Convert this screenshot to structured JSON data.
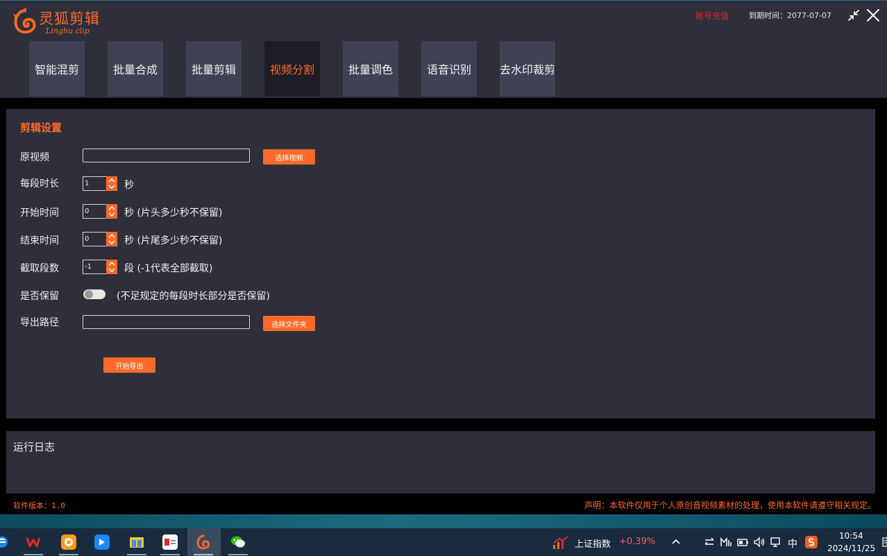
{
  "app": {
    "title": "灵狐剪辑",
    "subtitle": "Linghu clip",
    "recharge": "账号充值",
    "expiry": "到期时间：2077-07-07"
  },
  "tabs": [
    {
      "label": "智能混剪",
      "active": false
    },
    {
      "label": "批量合成",
      "active": false
    },
    {
      "label": "批量剪辑",
      "active": false
    },
    {
      "label": "视频分割",
      "active": true
    },
    {
      "label": "批量调色",
      "active": false
    },
    {
      "label": "语音识别",
      "active": false
    },
    {
      "label": "去水印裁剪",
      "active": false
    }
  ],
  "settings": {
    "title": "剪辑设置",
    "source_label": "原视频",
    "source_value": "",
    "select_video": "选择视频",
    "segment_label": "每段时长",
    "segment_value": "1",
    "segment_unit": "秒",
    "start_label": "开始时间",
    "start_value": "0",
    "start_hint": "秒 (片头多少秒不保留)",
    "end_label": "结束时间",
    "end_value": "0",
    "end_hint": "秒 (片尾多少秒不保留)",
    "count_label": "截取段数",
    "count_value": "-1",
    "count_hint": "段 (-1代表全部截取)",
    "keep_label": "是否保留",
    "keep_on": false,
    "keep_hint": "(不足规定的每段时长部分是否保留)",
    "export_label": "导出路径",
    "export_value": "",
    "select_folder": "选择文件夹",
    "start_export": "开始导出"
  },
  "log": {
    "title": "运行日志"
  },
  "footer": {
    "version": "软件版本：1.0",
    "disclaimer": "声明：本软件仅用于个人原创音视频素材的处理，使用本软件请遵守相关规定。"
  },
  "taskbar": {
    "stock_name": "上证指数",
    "stock_change": "+0.39%",
    "ime": "中",
    "time": "10:54",
    "date": "2024/11/25"
  },
  "colors": {
    "accent": "#ff6a2a",
    "panel": "#2e2f3a",
    "tab": "#3f4154",
    "tab_active": "#1c1d26",
    "recharge": "#e8262a",
    "stock_up": "#ff5a5a"
  }
}
